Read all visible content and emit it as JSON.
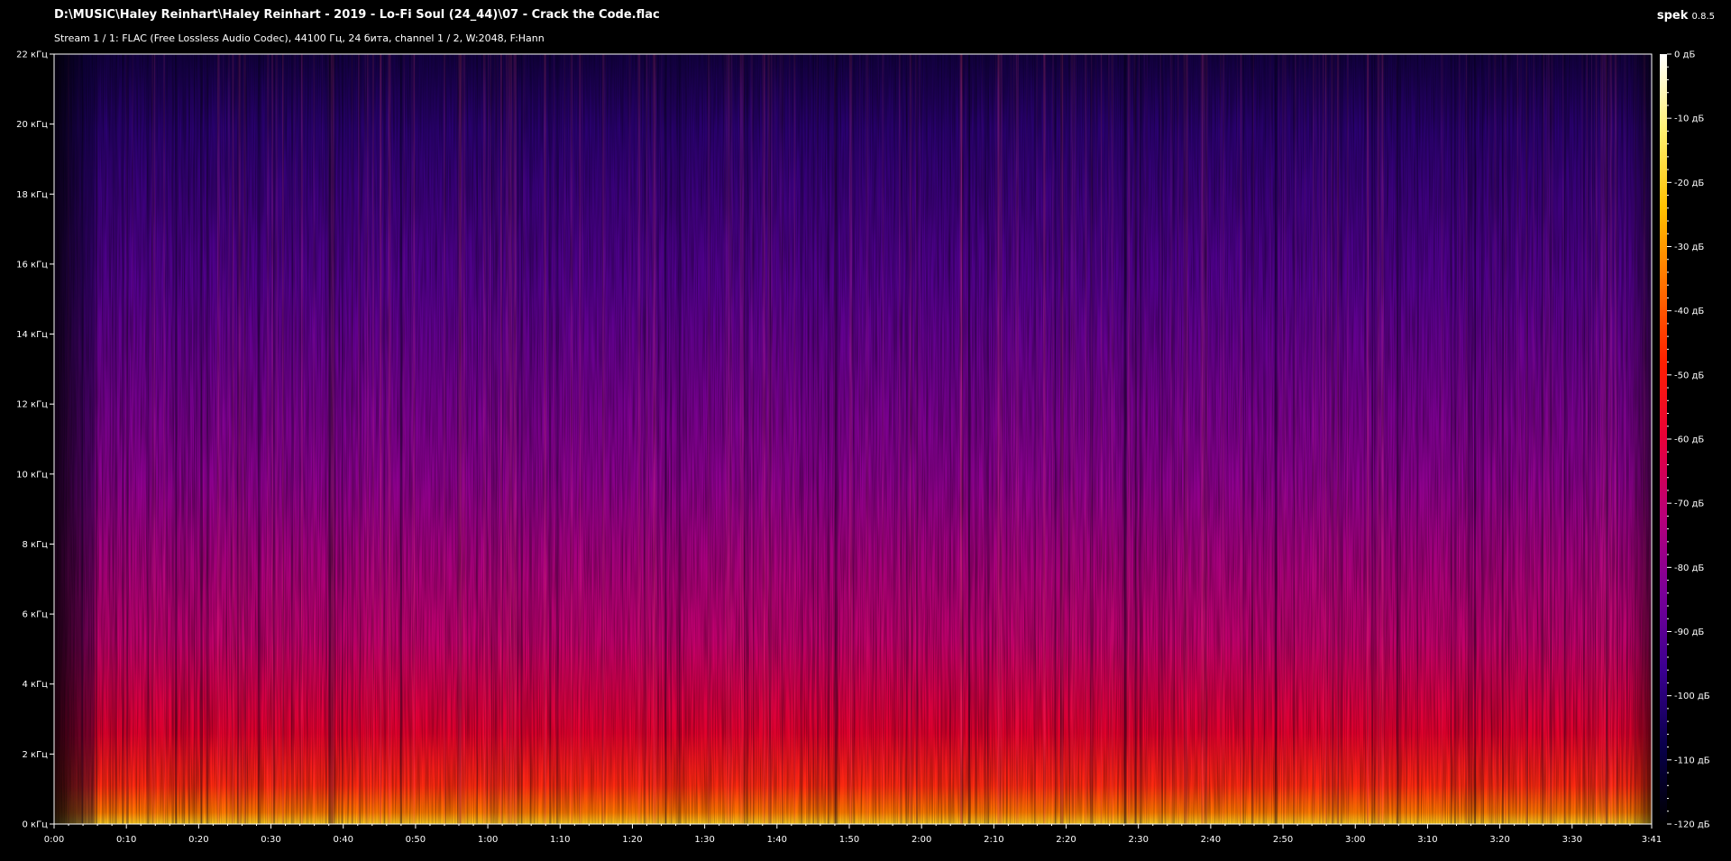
{
  "header": {
    "file_path": "D:\\MUSIC\\Haley Reinhart\\Haley Reinhart - 2019 - Lo-Fi Soul (24_44)\\07 - Crack the Code.flac",
    "stream_info": "Stream 1 / 1: FLAC (Free Lossless Audio Codec), 44100 Гц, 24 бита, channel 1 / 2, W:2048, F:Hann",
    "app_name": "spek",
    "app_version": "0.8.5"
  },
  "chart_data": {
    "type": "heatmap",
    "x_ticks": [
      "0:00",
      "0:10",
      "0:20",
      "0:30",
      "0:40",
      "0:50",
      "1:00",
      "1:10",
      "1:20",
      "1:30",
      "1:40",
      "1:50",
      "2:00",
      "2:10",
      "2:20",
      "2:30",
      "2:40",
      "2:50",
      "3:00",
      "3:10",
      "3:20",
      "3:30",
      "3:41"
    ],
    "x_tick_seconds": [
      0,
      10,
      20,
      30,
      40,
      50,
      60,
      70,
      80,
      90,
      100,
      110,
      120,
      130,
      140,
      150,
      160,
      170,
      180,
      190,
      200,
      210,
      221
    ],
    "xlim_seconds": [
      0,
      221
    ],
    "y_ticks": [
      "0 кГц",
      "2 кГц",
      "4 кГц",
      "6 кГц",
      "8 кГц",
      "10 кГц",
      "12 кГц",
      "14 кГц",
      "16 кГц",
      "18 кГц",
      "20 кГц",
      "22 кГц"
    ],
    "y_tick_khz": [
      0,
      2,
      4,
      6,
      8,
      10,
      12,
      14,
      16,
      18,
      20,
      22
    ],
    "ylim_khz": [
      0,
      22
    ],
    "colorbar_ticks": [
      "0 дБ",
      "-10 дБ",
      "-20 дБ",
      "-30 дБ",
      "-40 дБ",
      "-50 дБ",
      "-60 дБ",
      "-70 дБ",
      "-80 дБ",
      "-90 дБ",
      "-100 дБ",
      "-110 дБ",
      "-120 дБ"
    ],
    "colorbar_db": [
      0,
      -10,
      -20,
      -30,
      -40,
      -50,
      -60,
      -70,
      -80,
      -90,
      -100,
      -110,
      -120
    ],
    "colorbar_range_db": [
      -120,
      0
    ],
    "colormap": [
      "#000000",
      "#08004a",
      "#3a0090",
      "#7a0098",
      "#b8007a",
      "#e8003a",
      "#ff2000",
      "#ff7000",
      "#ffc000",
      "#fff070",
      "#ffffff"
    ]
  }
}
